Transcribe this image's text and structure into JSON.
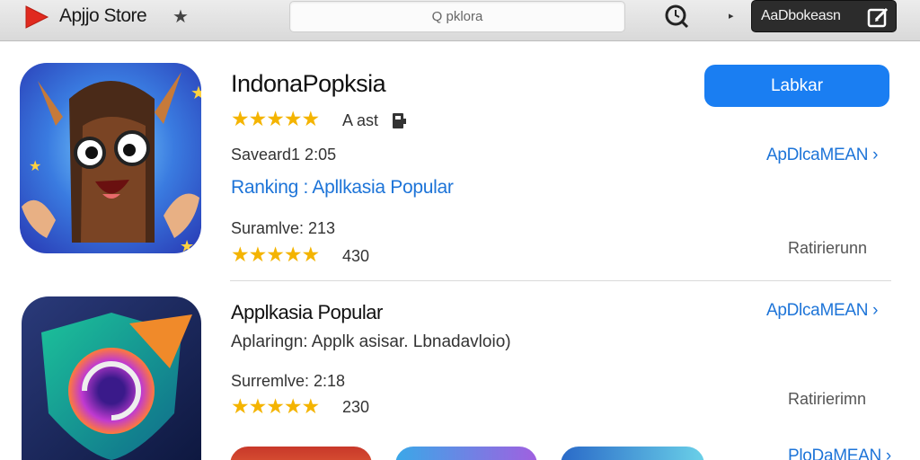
{
  "topbar": {
    "brand": "Apjjo Store",
    "star_glyph": "★",
    "search_placeholder": "Q pklora",
    "account_label": "AaDbokeasn"
  },
  "apps": [
    {
      "title": "IndonaPopksia",
      "rating_text": "A ast",
      "stars": "★★★★★",
      "meta1": "Saveard1 2:05",
      "ranking": "Ranking : Apllkasia Popular",
      "meta2": "Suramlve: 213",
      "stars2": "★★★★★",
      "count": "430",
      "button": "Labkar",
      "link": "ApDlcaMEAN ›",
      "right_label": "Ratirierunn"
    },
    {
      "title": "Applkasia Popular",
      "subtitle": "Aplaringn: Applk asisar. Lbnadavloio)",
      "meta2": "Surremlve: 2:18",
      "stars2": "★★★★★",
      "count": "230",
      "link": "ApDlcaMEAN ›",
      "right_label": "Ratirierimn"
    }
  ],
  "bottom_link": "PloDaMEAN ›",
  "colors": {
    "accent": "#1a7ef2",
    "link": "#1d74d8",
    "star": "#f4b400"
  }
}
